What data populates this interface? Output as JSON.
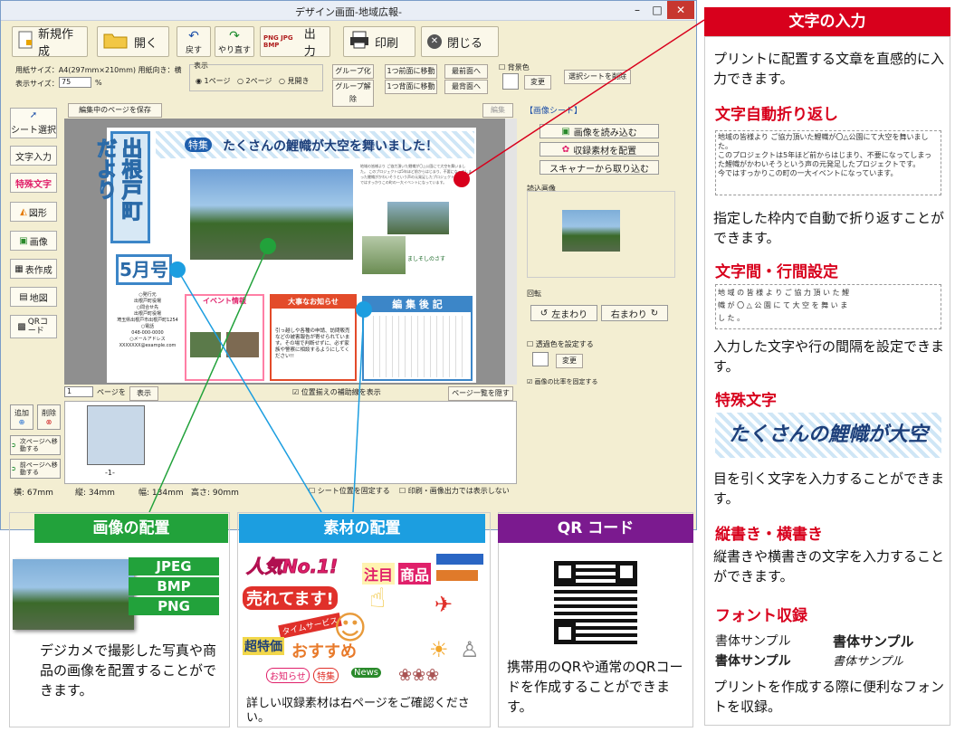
{
  "window": {
    "title": "デザイン画面-地域広報-",
    "min": "–",
    "max": "□",
    "close": "✕"
  },
  "toolbar": {
    "new": "新規作成",
    "open": "開く",
    "back": "戻す",
    "redo": "やり直す",
    "fmt": "PNG JPG BMP",
    "output": "出力",
    "print": "印刷",
    "close": "閉じる"
  },
  "options": {
    "paper_info": "用紙サイズ：A4(297mm×210mm) 用紙向き：横",
    "display_size_label": "表示サイズ：",
    "zoom": "75",
    "percent": "%",
    "display_group": "表示",
    "page1": "1ページ",
    "page2": "2ページ",
    "spread": "見開き",
    "group": "グループ化",
    "ungroup": "グループ解除",
    "front1": "1つ前面に移動",
    "back1": "1つ背面に移動",
    "front": "最前面へ",
    "back": "最背面へ",
    "bg_label": "背景色",
    "change": "変更",
    "sheet_select": "選択シートを削除"
  },
  "left_tools": [
    "シート選択",
    "文字入力",
    "特殊文字",
    "図形",
    "画像",
    "表作成",
    "地図",
    "QRコード"
  ],
  "canvas": {
    "save_page": "編集中のページを保存",
    "edit": "編集",
    "page_num": "1",
    "page_lbl": "ページを",
    "show": "表示",
    "guide_cb": "位置揃えの補助線を表示",
    "list_btn": "ページ一覧を隠す",
    "thumb_label": "-1-"
  },
  "newsletter": {
    "mast": "出根戸町だより",
    "month": "5月号",
    "headline": "たくさんの鯉幟が大空を舞いました！",
    "tag": "特集",
    "event": "イベント情報",
    "notice": "大事なお知らせ",
    "editorial": "編 集 後 記",
    "pub": "○発行元\n出根戸町役場\n○問合せ先\n出根戸町役場\n埼玉県出根戸市出根戸町1254\n○電話\n048-000-0000\n○メールアドレス\nXXXXXXX@example.com",
    "notice_text": "引っ越しや各種の申請、訪問販売などの被害報告が寄せられています。その場で判断せずに、必ず家族や警察に相談するようにしてください!!",
    "photo_caption": "ましそしのさす"
  },
  "page_ops": {
    "add": "追加",
    "del": "削除",
    "next": "次ページへ移動する",
    "prev": "前ページへ移動する"
  },
  "status": {
    "w": "横:  67mm",
    "h": "縦:  34mm",
    "width": "幅: 134mm",
    "height": "高さ: 90mm",
    "fix": "シート位置を固定する",
    "noprint": "印刷・画像出力では表示しない"
  },
  "rpanel": {
    "title": "【画像シート】",
    "load": "画像を読み込む",
    "place": "収録素材を配置",
    "scan": "スキャナーから取り込む",
    "loaded": "読込画像",
    "rotate": "回転",
    "left": "左まわり",
    "right": "右まわり",
    "trans": "透過色を設定する",
    "change": "変更",
    "ratio": "画像の比率を固定する"
  },
  "callouts": {
    "text_input": {
      "header": "文字の入力",
      "body": "プリントに配置する文章を直感的に入力できます。"
    },
    "wrap": {
      "header": "文字自動折り返し",
      "sample": "地域の皆様より ご協力頂いた鯉幟が〇△公園にて大空を舞いました。\nこのプロジェクトは5年ほど前からはじまり、不要になってしまった鯉幟がかわいそうという声の元発足したプロジェクトです。\n今ではすっかりこの町の一大イベントになっています。",
      "body": "指定した枠内で自動で折り返すことができます。"
    },
    "spacing": {
      "header": "文字間・行間設定",
      "sample": "地 域 の 皆 様 よ り ご 協 力 頂 い た 鯉\n幟 が 〇 △ 公 園 に て 大 空 を 舞 い ま\nし た 。",
      "body": "入力した文字や行の間隔を設定できます。"
    },
    "special": {
      "header": "特殊文字",
      "sample": "たくさんの鯉幟が大空",
      "body": "目を引く文字を入力することができます。"
    },
    "vertical": {
      "header": "縦書き・横書き",
      "body": "縦書きや横書きの文字を入力することができます。"
    },
    "font": {
      "header": "フォント収録",
      "s1": "書体サンプル",
      "s2": "書体サンプル",
      "s3": "書体サンプル",
      "s4": "書体サンプル",
      "body": "プリントを作成する際に便利なフォントを収録。"
    },
    "image": {
      "header": "画像の配置",
      "jpeg": "JPEG",
      "bmp": "BMP",
      "png": "PNG",
      "body": "デジカメで撮影した写真や商品の画像を配置することができます。"
    },
    "material": {
      "header": "素材の配置",
      "w1": "人気No.1!",
      "w2": "注目",
      "w3": "商品",
      "w4": "売れてます!",
      "w5": "超特価",
      "w6": "おすすめ",
      "w7": "タイムサービス",
      "w8": "お知らせ",
      "w9": "特集",
      "w10": "News",
      "body": "詳しい収録素材は右ページをご確認ください。"
    },
    "qr": {
      "header": "QR コード",
      "body": "携帯用のQRや通常のQRコードを作成することができます。"
    }
  },
  "colors": {
    "red": "#d8001c",
    "green": "#22a23b",
    "blue": "#1c9ee0",
    "purple": "#7b1a8f"
  }
}
